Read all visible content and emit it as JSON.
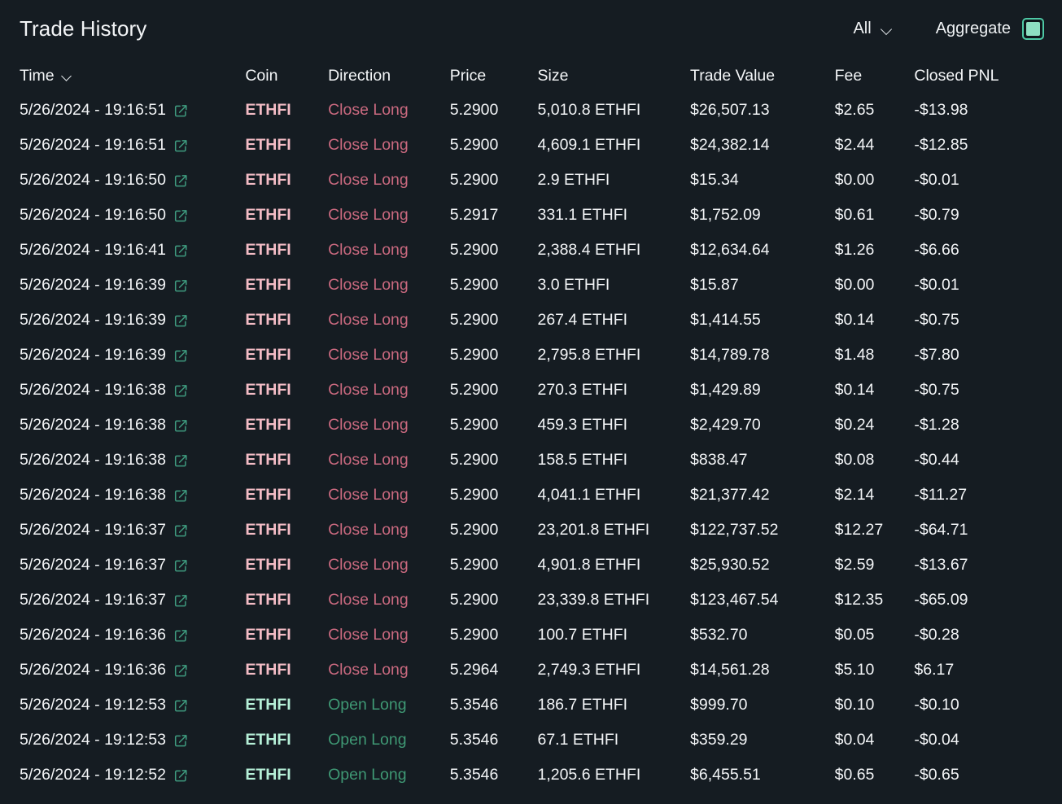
{
  "header": {
    "title": "Trade History",
    "filter_value": "All",
    "filter_icon": "chevron-down-icon",
    "aggregate_label": "Aggregate",
    "aggregate_checked": true
  },
  "colors": {
    "background": "#151c22",
    "text": "#f2f4f6",
    "accent_teal": "#4ec9a5",
    "checkbox_fill": "#8ddfc2",
    "coin_long": "#f3bcc5",
    "coin_short": "#b5efd7",
    "direction_close": "#c9697f",
    "direction_open": "#3f9874"
  },
  "table": {
    "columns": [
      {
        "key": "time",
        "label": "Time",
        "sortable": true,
        "sort_icon": "chevron-down-icon",
        "underlined": false
      },
      {
        "key": "coin",
        "label": "Coin",
        "sortable": false,
        "underlined": false
      },
      {
        "key": "direction",
        "label": "Direction",
        "sortable": false,
        "underlined": false
      },
      {
        "key": "price",
        "label": "Price",
        "sortable": false,
        "underlined": false
      },
      {
        "key": "size",
        "label": "Size",
        "sortable": false,
        "underlined": false
      },
      {
        "key": "value",
        "label": "Trade Value",
        "sortable": false,
        "underlined": false
      },
      {
        "key": "fee",
        "label": "Fee",
        "sortable": false,
        "underlined": false
      },
      {
        "key": "pnl",
        "label": "Closed PNL",
        "sortable": false,
        "underlined": true
      }
    ],
    "row_link_icon": "external-link-icon",
    "rows": [
      {
        "time": "5/26/2024 - 19:16:51",
        "coin": "ETHFI",
        "direction": "Close Long",
        "price": "5.2900",
        "size": "5,010.8 ETHFI",
        "value": "$26,507.13",
        "fee": "$2.65",
        "pnl": "-$13.98"
      },
      {
        "time": "5/26/2024 - 19:16:51",
        "coin": "ETHFI",
        "direction": "Close Long",
        "price": "5.2900",
        "size": "4,609.1 ETHFI",
        "value": "$24,382.14",
        "fee": "$2.44",
        "pnl": "-$12.85"
      },
      {
        "time": "5/26/2024 - 19:16:50",
        "coin": "ETHFI",
        "direction": "Close Long",
        "price": "5.2900",
        "size": "2.9 ETHFI",
        "value": "$15.34",
        "fee": "$0.00",
        "pnl": "-$0.01"
      },
      {
        "time": "5/26/2024 - 19:16:50",
        "coin": "ETHFI",
        "direction": "Close Long",
        "price": "5.2917",
        "size": "331.1 ETHFI",
        "value": "$1,752.09",
        "fee": "$0.61",
        "pnl": "-$0.79"
      },
      {
        "time": "5/26/2024 - 19:16:41",
        "coin": "ETHFI",
        "direction": "Close Long",
        "price": "5.2900",
        "size": "2,388.4 ETHFI",
        "value": "$12,634.64",
        "fee": "$1.26",
        "pnl": "-$6.66"
      },
      {
        "time": "5/26/2024 - 19:16:39",
        "coin": "ETHFI",
        "direction": "Close Long",
        "price": "5.2900",
        "size": "3.0 ETHFI",
        "value": "$15.87",
        "fee": "$0.00",
        "pnl": "-$0.01"
      },
      {
        "time": "5/26/2024 - 19:16:39",
        "coin": "ETHFI",
        "direction": "Close Long",
        "price": "5.2900",
        "size": "267.4 ETHFI",
        "value": "$1,414.55",
        "fee": "$0.14",
        "pnl": "-$0.75"
      },
      {
        "time": "5/26/2024 - 19:16:39",
        "coin": "ETHFI",
        "direction": "Close Long",
        "price": "5.2900",
        "size": "2,795.8 ETHFI",
        "value": "$14,789.78",
        "fee": "$1.48",
        "pnl": "-$7.80"
      },
      {
        "time": "5/26/2024 - 19:16:38",
        "coin": "ETHFI",
        "direction": "Close Long",
        "price": "5.2900",
        "size": "270.3 ETHFI",
        "value": "$1,429.89",
        "fee": "$0.14",
        "pnl": "-$0.75"
      },
      {
        "time": "5/26/2024 - 19:16:38",
        "coin": "ETHFI",
        "direction": "Close Long",
        "price": "5.2900",
        "size": "459.3 ETHFI",
        "value": "$2,429.70",
        "fee": "$0.24",
        "pnl": "-$1.28"
      },
      {
        "time": "5/26/2024 - 19:16:38",
        "coin": "ETHFI",
        "direction": "Close Long",
        "price": "5.2900",
        "size": "158.5 ETHFI",
        "value": "$838.47",
        "fee": "$0.08",
        "pnl": "-$0.44"
      },
      {
        "time": "5/26/2024 - 19:16:38",
        "coin": "ETHFI",
        "direction": "Close Long",
        "price": "5.2900",
        "size": "4,041.1 ETHFI",
        "value": "$21,377.42",
        "fee": "$2.14",
        "pnl": "-$11.27"
      },
      {
        "time": "5/26/2024 - 19:16:37",
        "coin": "ETHFI",
        "direction": "Close Long",
        "price": "5.2900",
        "size": "23,201.8 ETHFI",
        "value": "$122,737.52",
        "fee": "$12.27",
        "pnl": "-$64.71"
      },
      {
        "time": "5/26/2024 - 19:16:37",
        "coin": "ETHFI",
        "direction": "Close Long",
        "price": "5.2900",
        "size": "4,901.8 ETHFI",
        "value": "$25,930.52",
        "fee": "$2.59",
        "pnl": "-$13.67"
      },
      {
        "time": "5/26/2024 - 19:16:37",
        "coin": "ETHFI",
        "direction": "Close Long",
        "price": "5.2900",
        "size": "23,339.8 ETHFI",
        "value": "$123,467.54",
        "fee": "$12.35",
        "pnl": "-$65.09"
      },
      {
        "time": "5/26/2024 - 19:16:36",
        "coin": "ETHFI",
        "direction": "Close Long",
        "price": "5.2900",
        "size": "100.7 ETHFI",
        "value": "$532.70",
        "fee": "$0.05",
        "pnl": "-$0.28"
      },
      {
        "time": "5/26/2024 - 19:16:36",
        "coin": "ETHFI",
        "direction": "Close Long",
        "price": "5.2964",
        "size": "2,749.3 ETHFI",
        "value": "$14,561.28",
        "fee": "$5.10",
        "pnl": "$6.17"
      },
      {
        "time": "5/26/2024 - 19:12:53",
        "coin": "ETHFI",
        "direction": "Open Long",
        "price": "5.3546",
        "size": "186.7 ETHFI",
        "value": "$999.70",
        "fee": "$0.10",
        "pnl": "-$0.10"
      },
      {
        "time": "5/26/2024 - 19:12:53",
        "coin": "ETHFI",
        "direction": "Open Long",
        "price": "5.3546",
        "size": "67.1 ETHFI",
        "value": "$359.29",
        "fee": "$0.04",
        "pnl": "-$0.04"
      },
      {
        "time": "5/26/2024 - 19:12:52",
        "coin": "ETHFI",
        "direction": "Open Long",
        "price": "5.3546",
        "size": "1,205.6 ETHFI",
        "value": "$6,455.51",
        "fee": "$0.65",
        "pnl": "-$0.65"
      }
    ]
  }
}
